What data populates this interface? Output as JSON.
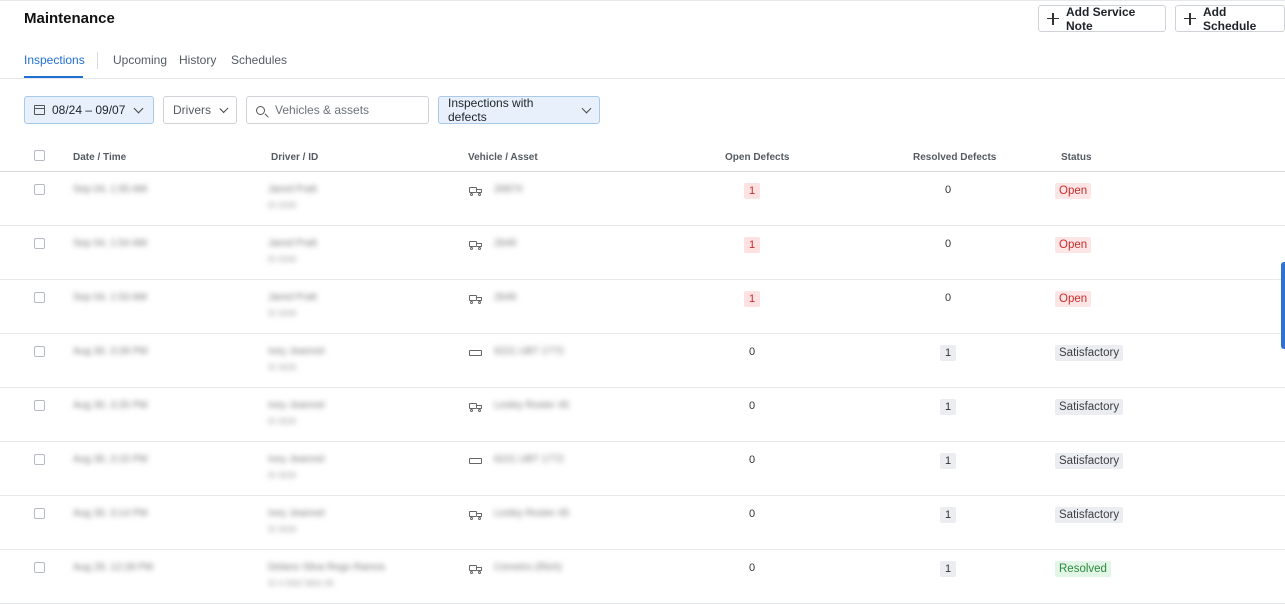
{
  "page": {
    "title": "Maintenance",
    "add_service_note_label": "Add Service Note",
    "add_schedule_label": "Add Schedule"
  },
  "tabs": [
    {
      "label": "Inspections",
      "active": true
    },
    {
      "label": "Upcoming",
      "active": false
    },
    {
      "label": "History",
      "active": false
    },
    {
      "label": "Schedules",
      "active": false
    }
  ],
  "filters": {
    "date_range": "08/24 – 09/07",
    "drivers": "Drivers",
    "search_placeholder": "Vehicles & assets",
    "defects": "Inspections with defects"
  },
  "table": {
    "columns": [
      "Date / Time",
      "Driver / ID",
      "Vehicle / Asset",
      "Open Defects",
      "Resolved Defects",
      "Status"
    ],
    "rows": [
      {
        "date": "Sep 04, 1:55 AM",
        "driver": "Jared Pratt",
        "driver_id": "ID 2049",
        "vehicle_type": "truck",
        "vehicle": "2687X",
        "open": "1",
        "resolved": "0",
        "status": "Open",
        "status_kind": "open"
      },
      {
        "date": "Sep 04, 1:54 AM",
        "driver": "Jared Pratt",
        "driver_id": "ID 2049",
        "vehicle_type": "truck",
        "vehicle": "2649",
        "open": "1",
        "resolved": "0",
        "status": "Open",
        "status_kind": "open"
      },
      {
        "date": "Sep 04, 1:53 AM",
        "driver": "Jared Pratt",
        "driver_id": "ID 2049",
        "vehicle_type": "truck",
        "vehicle": "2649",
        "open": "1",
        "resolved": "0",
        "status": "Open",
        "status_kind": "open"
      },
      {
        "date": "Aug 30, 3:28 PM",
        "driver": "Ivey Jeannet",
        "driver_id": "ID 3026",
        "vehicle_type": "trailer",
        "vehicle": "6221 UBT 1772",
        "open": "0",
        "resolved": "1",
        "status": "Satisfactory",
        "status_kind": "satisfactory"
      },
      {
        "date": "Aug 30, 3:25 PM",
        "driver": "Ivey Jeannet",
        "driver_id": "ID 3026",
        "vehicle_type": "truck",
        "vehicle": "Lesley Roster 45",
        "open": "0",
        "resolved": "1",
        "status": "Satisfactory",
        "status_kind": "satisfactory"
      },
      {
        "date": "Aug 30, 3:15 PM",
        "driver": "Ivey Jeannet",
        "driver_id": "ID 3026",
        "vehicle_type": "trailer",
        "vehicle": "6221 UBT 1772",
        "open": "0",
        "resolved": "1",
        "status": "Satisfactory",
        "status_kind": "satisfactory"
      },
      {
        "date": "Aug 30, 3:14 PM",
        "driver": "Ivey Jeannet",
        "driver_id": "ID 3026",
        "vehicle_type": "truck",
        "vehicle": "Lesley Roster 45",
        "open": "0",
        "resolved": "1",
        "status": "Satisfactory",
        "status_kind": "satisfactory"
      },
      {
        "date": "Aug 29, 12:28 PM",
        "driver": "Delano Silva Rego Ramos",
        "driver_id": "ID 4 5562 9841 85",
        "vehicle_type": "truck",
        "vehicle": "Cemetro (Rich)",
        "open": "0",
        "resolved": "1",
        "status": "Resolved",
        "status_kind": "resolved"
      }
    ]
  }
}
